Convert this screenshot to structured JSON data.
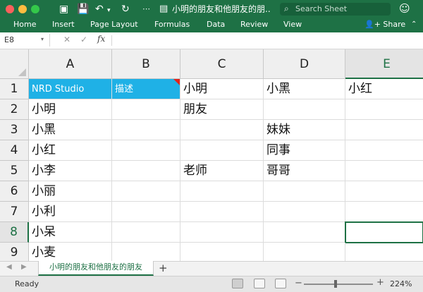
{
  "window": {
    "title": "小明的朋友和他朋友的朋...",
    "search_placeholder": "Search Sheet"
  },
  "ribbon": {
    "tabs": [
      "Home",
      "Insert",
      "Page Layout",
      "Formulas",
      "Data",
      "Review",
      "View"
    ],
    "share_label": "Share"
  },
  "formula_bar": {
    "cell_ref": "E8",
    "fx_label": "fx",
    "content": ""
  },
  "grid": {
    "columns": [
      "A",
      "B",
      "C",
      "D",
      "E"
    ],
    "rows": [
      "1",
      "2",
      "3",
      "4",
      "5",
      "6",
      "7",
      "8",
      "9"
    ],
    "selected_column": "E",
    "selected_row": "8",
    "cells": [
      [
        "NRD Studio",
        "描述",
        "小明",
        "小黑",
        "小红"
      ],
      [
        "小明",
        "",
        "朋友",
        "",
        ""
      ],
      [
        "小黑",
        "",
        "",
        "妹妹",
        ""
      ],
      [
        "小红",
        "",
        "",
        "同事",
        ""
      ],
      [
        "小李",
        "",
        "老师",
        "哥哥",
        ""
      ],
      [
        "小丽",
        "",
        "",
        "",
        ""
      ],
      [
        "小利",
        "",
        "",
        "",
        ""
      ],
      [
        "小呆",
        "",
        "",
        "",
        ""
      ],
      [
        "小麦",
        "",
        "",
        "",
        ""
      ]
    ]
  },
  "sheet_tabs": {
    "active": "小明的朋友和他朋友的朋友",
    "add_label": "+"
  },
  "status": {
    "text": "Ready",
    "zoom": "224%",
    "zoom_minus": "−",
    "zoom_plus": "+"
  },
  "colors": {
    "excel_green": "#1e7145",
    "header_fill": "#1fb1e6",
    "comment_marker": "#e2231a"
  }
}
